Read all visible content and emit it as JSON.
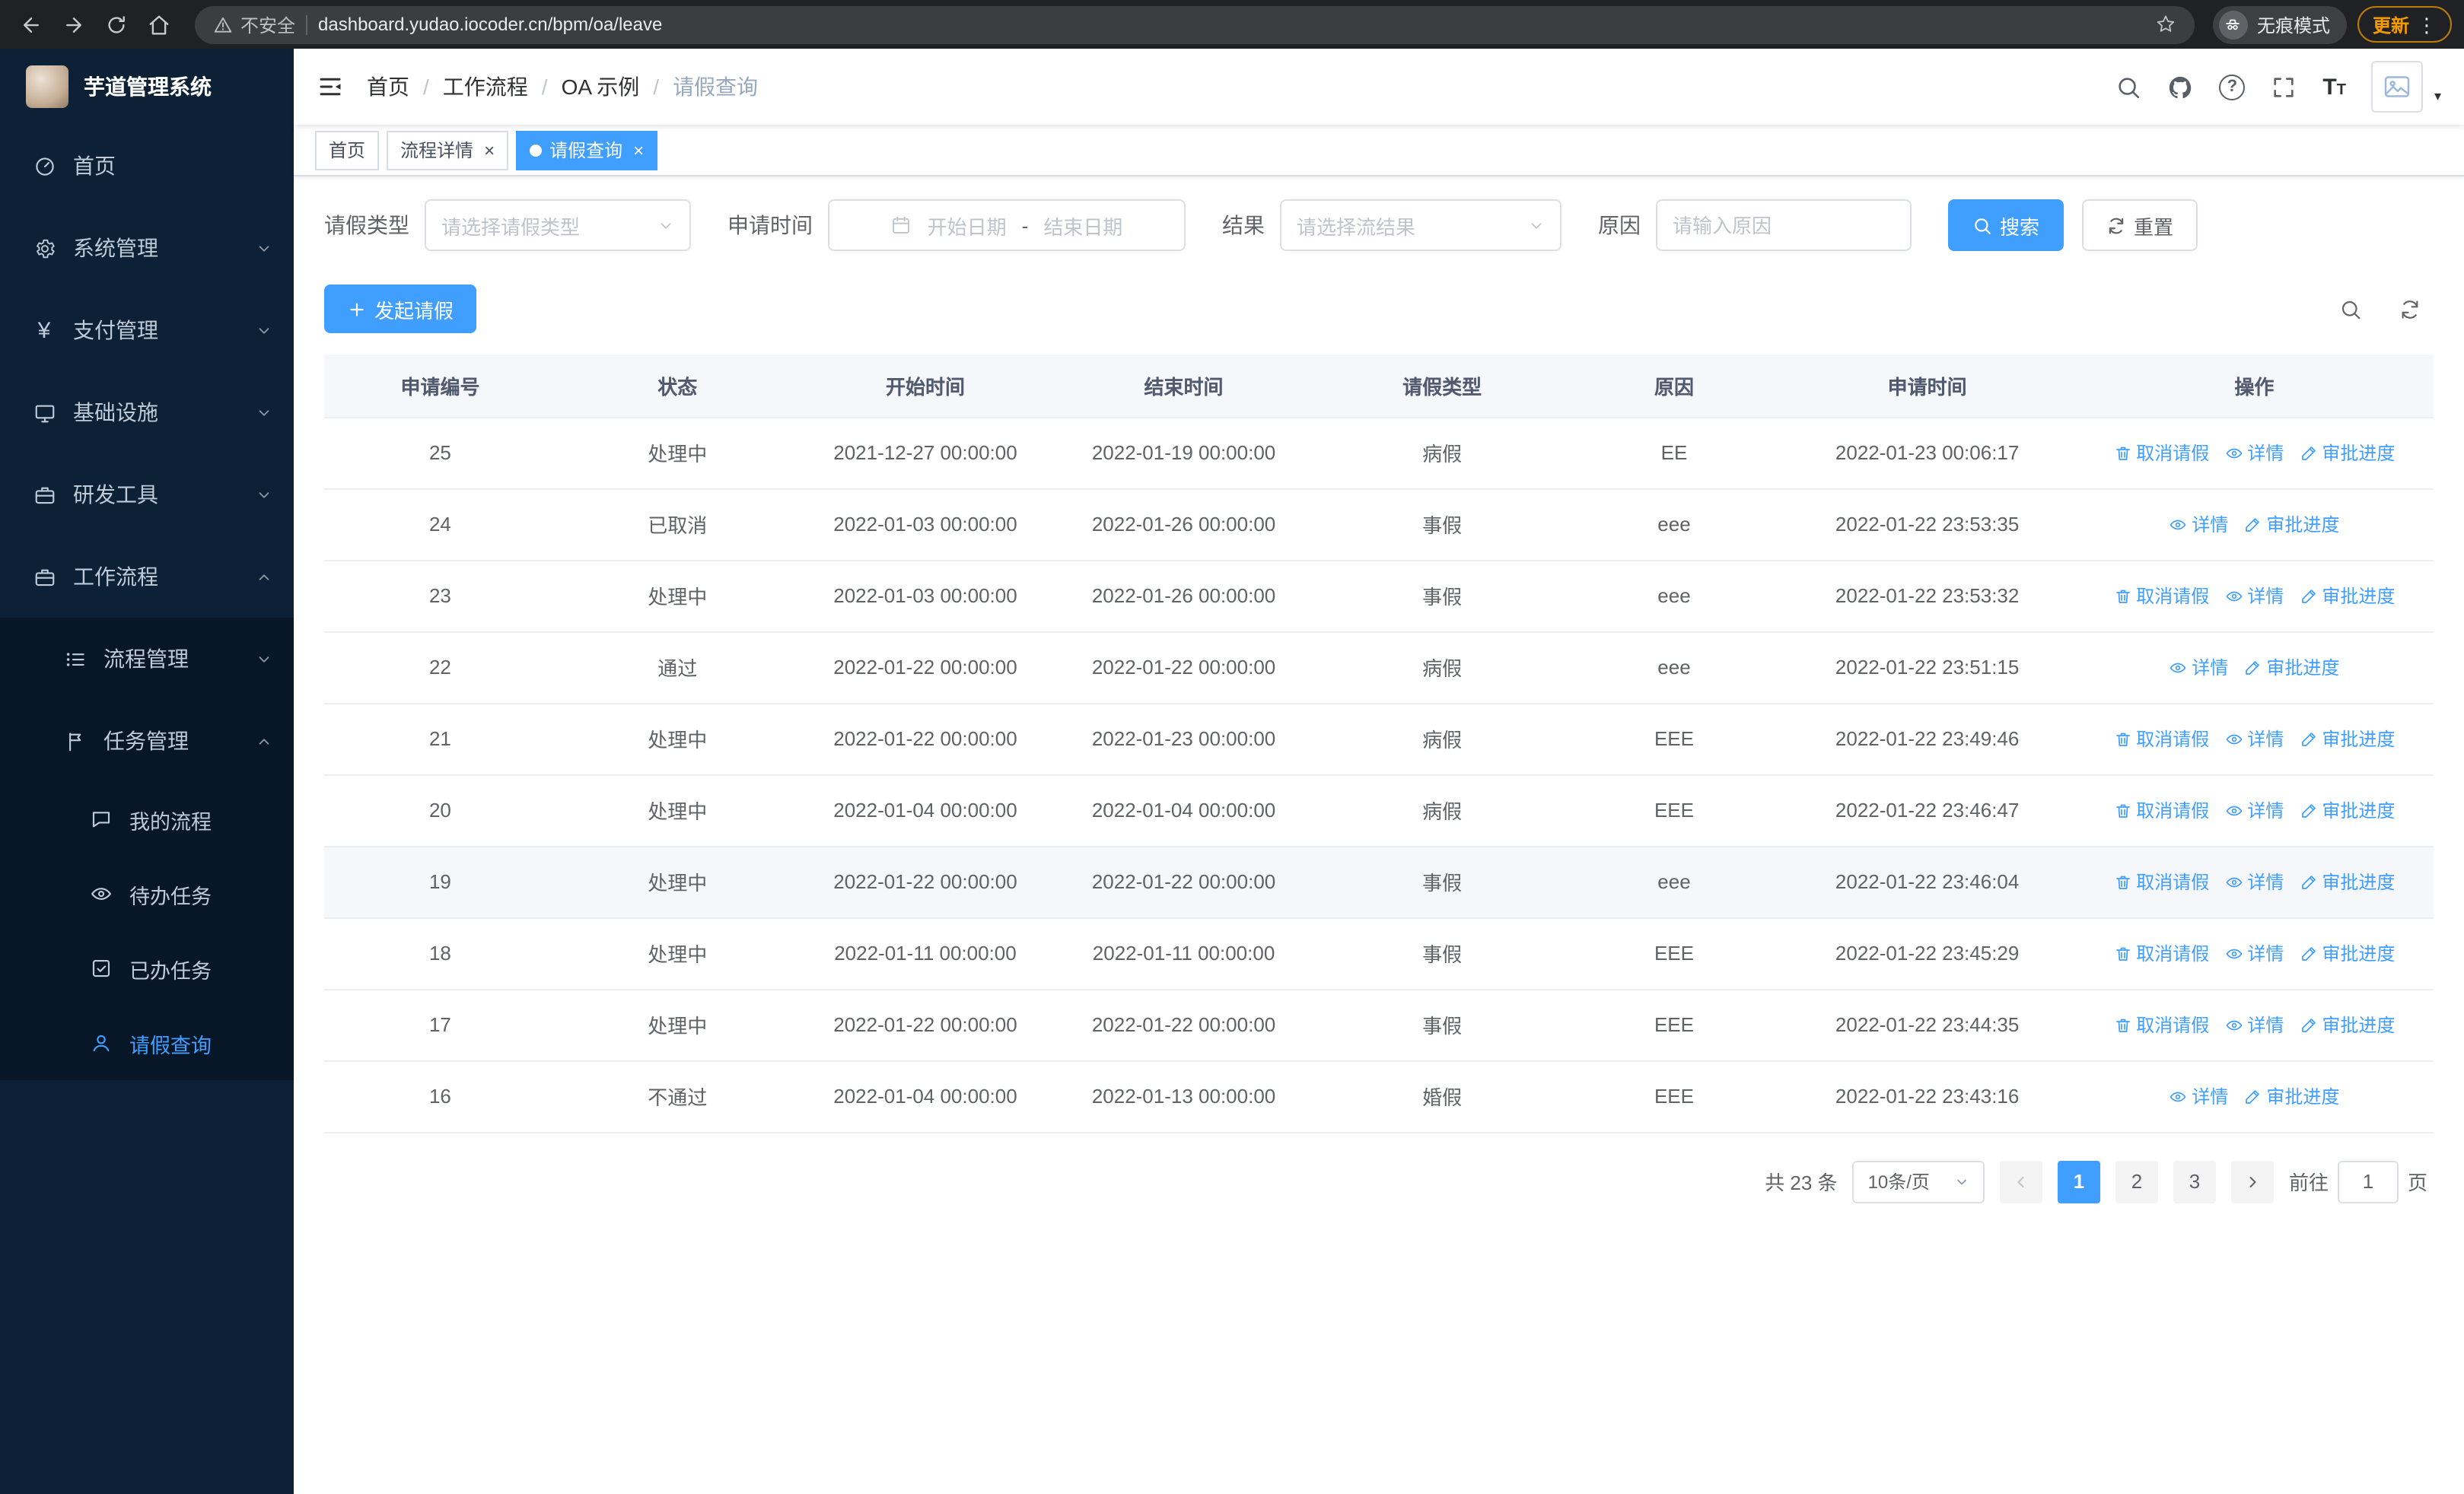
{
  "colors": {
    "primary": "#409eff",
    "sidebar_bg": "#0c2135",
    "sidebar_submenu_bg": "#081727",
    "update_chip": "#f29900"
  },
  "browser": {
    "security_label": "不安全",
    "url": "dashboard.yudao.iocoder.cn/bpm/oa/leave",
    "incognito_label": "无痕模式",
    "update_label": "更新"
  },
  "sidebar": {
    "logo_title": "芋道管理系统",
    "menu": {
      "home": "首页",
      "system": "系统管理",
      "payment": "支付管理",
      "infra": "基础设施",
      "devtools": "研发工具",
      "workflow": "工作流程",
      "process_mgmt": "流程管理",
      "task_mgmt": "任务管理",
      "my_process": "我的流程",
      "todo_task": "待办任务",
      "done_task": "已办任务",
      "leave_query": "请假查询"
    }
  },
  "breadcrumb": [
    "首页",
    "工作流程",
    "OA 示例",
    "请假查询"
  ],
  "breadcrumb_separator": "/",
  "tabs": [
    {
      "label": "首页",
      "closable": false,
      "active": false
    },
    {
      "label": "流程详情",
      "closable": true,
      "active": false
    },
    {
      "label": "请假查询",
      "closable": true,
      "active": true
    }
  ],
  "filters": {
    "leave_type_label": "请假类型",
    "leave_type_placeholder": "请选择请假类型",
    "apply_time_label": "申请时间",
    "date_start_placeholder": "开始日期",
    "date_separator": "-",
    "date_end_placeholder": "结束日期",
    "result_label": "结果",
    "result_placeholder": "请选择流结果",
    "reason_label": "原因",
    "reason_placeholder": "请输入原因",
    "search_button": "搜索",
    "reset_button": "重置"
  },
  "toolbar": {
    "create_button": "发起请假"
  },
  "table": {
    "headers": [
      "申请编号",
      "状态",
      "开始时间",
      "结束时间",
      "请假类型",
      "原因",
      "申请时间",
      "操作"
    ],
    "action_labels": {
      "cancel": "取消请假",
      "detail": "详情",
      "progress": "审批进度"
    },
    "rows": [
      {
        "id": "25",
        "status": "处理中",
        "start": "2021-12-27 00:00:00",
        "end": "2022-01-19 00:00:00",
        "type": "病假",
        "reason": "EE",
        "apply_time": "2022-01-23 00:06:17",
        "actions": [
          "cancel",
          "detail",
          "progress"
        ]
      },
      {
        "id": "24",
        "status": "已取消",
        "start": "2022-01-03 00:00:00",
        "end": "2022-01-26 00:00:00",
        "type": "事假",
        "reason": "eee",
        "apply_time": "2022-01-22 23:53:35",
        "actions": [
          "detail",
          "progress"
        ]
      },
      {
        "id": "23",
        "status": "处理中",
        "start": "2022-01-03 00:00:00",
        "end": "2022-01-26 00:00:00",
        "type": "事假",
        "reason": "eee",
        "apply_time": "2022-01-22 23:53:32",
        "actions": [
          "cancel",
          "detail",
          "progress"
        ]
      },
      {
        "id": "22",
        "status": "通过",
        "start": "2022-01-22 00:00:00",
        "end": "2022-01-22 00:00:00",
        "type": "病假",
        "reason": "eee",
        "apply_time": "2022-01-22 23:51:15",
        "actions": [
          "detail",
          "progress"
        ]
      },
      {
        "id": "21",
        "status": "处理中",
        "start": "2022-01-22 00:00:00",
        "end": "2022-01-23 00:00:00",
        "type": "病假",
        "reason": "EEE",
        "apply_time": "2022-01-22 23:49:46",
        "actions": [
          "cancel",
          "detail",
          "progress"
        ]
      },
      {
        "id": "20",
        "status": "处理中",
        "start": "2022-01-04 00:00:00",
        "end": "2022-01-04 00:00:00",
        "type": "病假",
        "reason": "EEE",
        "apply_time": "2022-01-22 23:46:47",
        "actions": [
          "cancel",
          "detail",
          "progress"
        ]
      },
      {
        "id": "19",
        "status": "处理中",
        "start": "2022-01-22 00:00:00",
        "end": "2022-01-22 00:00:00",
        "type": "事假",
        "reason": "eee",
        "apply_time": "2022-01-22 23:46:04",
        "actions": [
          "cancel",
          "detail",
          "progress"
        ],
        "highlight": true
      },
      {
        "id": "18",
        "status": "处理中",
        "start": "2022-01-11 00:00:00",
        "end": "2022-01-11 00:00:00",
        "type": "事假",
        "reason": "EEE",
        "apply_time": "2022-01-22 23:45:29",
        "actions": [
          "cancel",
          "detail",
          "progress"
        ]
      },
      {
        "id": "17",
        "status": "处理中",
        "start": "2022-01-22 00:00:00",
        "end": "2022-01-22 00:00:00",
        "type": "事假",
        "reason": "EEE",
        "apply_time": "2022-01-22 23:44:35",
        "actions": [
          "cancel",
          "detail",
          "progress"
        ]
      },
      {
        "id": "16",
        "status": "不通过",
        "start": "2022-01-04 00:00:00",
        "end": "2022-01-13 00:00:00",
        "type": "婚假",
        "reason": "EEE",
        "apply_time": "2022-01-22 23:43:16",
        "actions": [
          "detail",
          "progress"
        ]
      }
    ]
  },
  "pagination": {
    "total": "共 23 条",
    "page_size": "10条/页",
    "pages": [
      "1",
      "2",
      "3"
    ],
    "current": "1",
    "goto_label": "前往",
    "goto_value": "1",
    "goto_suffix": "页"
  }
}
